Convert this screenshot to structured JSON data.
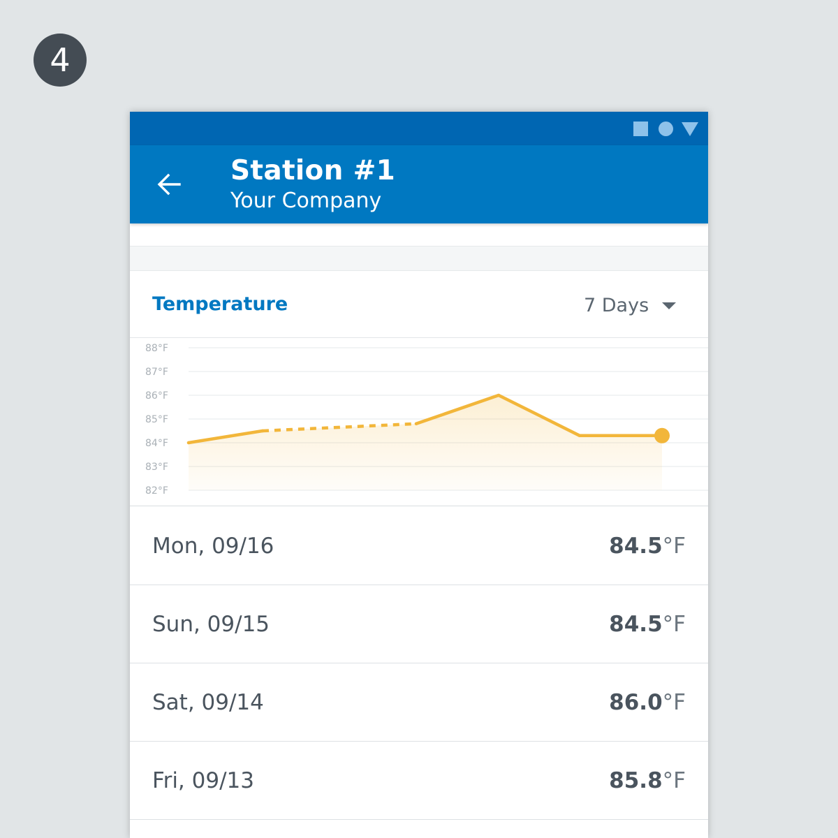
{
  "step_number": "4",
  "colors": {
    "status_bar": "#0066b2",
    "app_bar": "#0078c1",
    "accent": "#0078c1",
    "chart_line": "#f2b63a",
    "status_icons": "#8ec2ea"
  },
  "status_bar": {
    "icons": [
      "square-icon",
      "circle-icon",
      "triangle-icon"
    ]
  },
  "app_bar": {
    "back_icon": "arrow-left-icon",
    "title": "Station #1",
    "subtitle": "Your Company"
  },
  "card": {
    "title": "Temperature",
    "range": {
      "selected": "7 Days",
      "icon": "caret-down-icon"
    }
  },
  "chart_data": {
    "type": "line",
    "y_ticks": [
      "88°F",
      "87°F",
      "86°F",
      "85°F",
      "84°F",
      "83°F",
      "82°F"
    ],
    "ylim": [
      82,
      88
    ],
    "grid": true,
    "area_fill": true,
    "x": [
      0,
      1,
      2,
      3,
      4,
      5
    ],
    "values": [
      84.0,
      84.5,
      84.8,
      86.0,
      84.3,
      84.3
    ],
    "dashed_segments": [
      [
        1,
        2
      ]
    ],
    "end_marker": true
  },
  "readings": [
    {
      "date": "Mon, 09/16",
      "value": "84.5",
      "unit": "°F"
    },
    {
      "date": "Sun, 09/15",
      "value": "84.5",
      "unit": "°F"
    },
    {
      "date": "Sat, 09/14",
      "value": "86.0",
      "unit": "°F"
    },
    {
      "date": "Fri, 09/13",
      "value": "85.8",
      "unit": "°F"
    }
  ]
}
